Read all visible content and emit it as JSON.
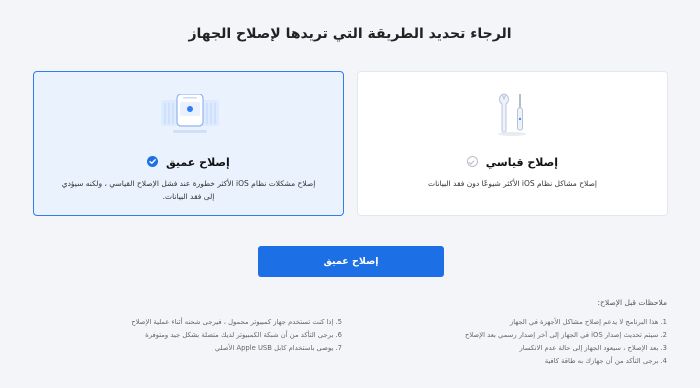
{
  "page": {
    "title": "الرجاء تحديد الطريقة التي تريدها لإصلاح الجهاز"
  },
  "deep_repair": {
    "title": "إصلاح عميق",
    "description": "إصلاح مشكلات نظام iOS الأكثر خطورة عند فشل الإصلاح القياسي ، ولكنه سيؤدي إلى فقد البيانات.",
    "selected": true
  },
  "standard_repair": {
    "title": "إصلاح قياسي",
    "description": "إصلاح مشاكل نظام iOS الأكثر شيوعًا دون فقد البيانات",
    "selected": false
  },
  "action_button": {
    "label": "إصلاح عميق"
  },
  "notes": {
    "title": "ملاحظات قبل الإصلاح:",
    "items": [
      "1. هذا البرنامج لا يدعم إصلاح مشاكل الأجهزة في الجهاز",
      "2. سيتم تحديث إصدار iOS في الجهاز إلى آخر إصدار رسمي بعد الإصلاح",
      "3. بعد الإصلاح ، سيعود الجهاز إلى حالة عدم الانكسار",
      "4. برجى التأكد من أن جهازك به طاقة كافية",
      "5. إذا كنت تستخدم جهاز كمبيوتر محمول ، فيرجى شحنه أثناء عملية الإصلاح",
      "6. برجى التأكد من أن شبكة الكمبيوتر لديك متصلة بشكل جيد ومتوفرة",
      "7. يوصى باستخدام كابل Apple USB الأصلي"
    ]
  },
  "colors": {
    "accent": "#1c6fe4",
    "selected_bg": "#eaf2fe",
    "page_bg": "#f3f5f8"
  },
  "icons": {
    "deep": "device-repair-icon",
    "standard": "tools-icon"
  }
}
